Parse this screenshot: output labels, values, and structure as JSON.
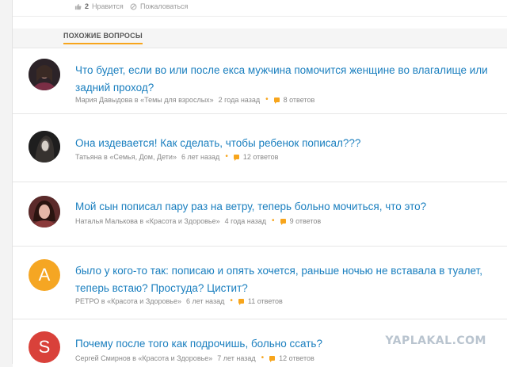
{
  "actions": {
    "like_count": "2",
    "like_label": "Нравится",
    "report_label": "Пожаловаться"
  },
  "section": {
    "title": "ПОХОЖИЕ ВОПРОСЫ"
  },
  "questions": [
    {
      "title": "Что будет, если во или после екса мужчина помочится женщине во влагалище или задний проход?",
      "author_in": "Мария Давыдова в «Темы для взрослых»",
      "time": "2 года назад",
      "answers": "8 ответов"
    },
    {
      "title": "Она издевается! Как сделать, чтобы ребенок пописал???",
      "author_in": "Татьяна в «Семья, Дом, Дети»",
      "time": "6 лет назад",
      "answers": "12 ответов"
    },
    {
      "title": "Мой сын пописал пару раз на ветру, теперь больно мочиться, что это?",
      "author_in": "Наталья Малькова в «Красота и Здоровье»",
      "time": "4 года назад",
      "answers": "9 ответов"
    },
    {
      "title": "было у кого-то так: пописаю и опять хочется, раньше ночью не вставала в туалет, теперь встаю? Простуда? Цистит?",
      "author_in": "РЕТРО в «Красота и Здоровье»",
      "time": "6 лет назад",
      "answers": "11 ответов",
      "avatar_letter": "A"
    },
    {
      "title": "Почему после того как подрочишь, больно ссать?",
      "author_in": "Сергей Смирнов в «Красота и Здоровье»",
      "time": "7 лет назад",
      "answers": "12 ответов",
      "avatar_letter": "S"
    }
  ],
  "watermark": "YAPLAKAL.COM",
  "colors": {
    "link": "#1a7fbf",
    "accent": "#f7a51c",
    "avatar_a": "#f5a623",
    "avatar_s": "#d9413a"
  }
}
